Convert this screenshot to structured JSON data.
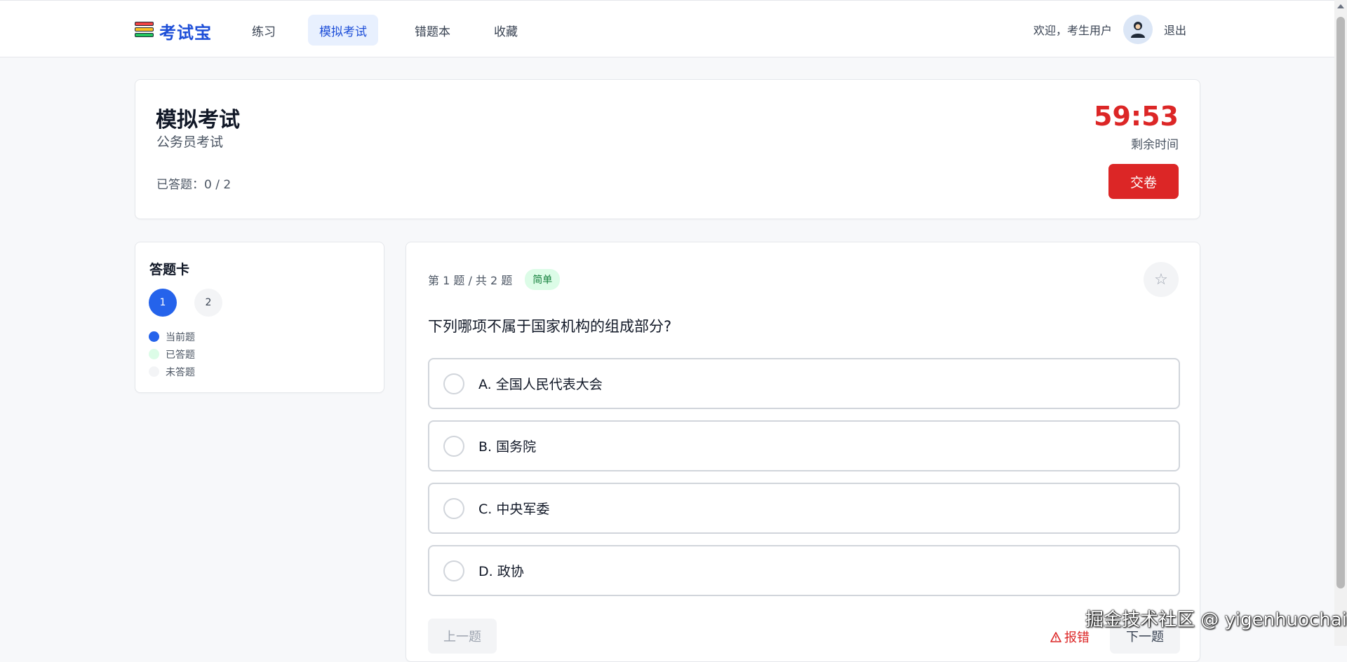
{
  "header": {
    "brand": "考试宝",
    "nav": [
      {
        "label": "练习",
        "active": false
      },
      {
        "label": "模拟考试",
        "active": true
      },
      {
        "label": "错题本",
        "active": false
      },
      {
        "label": "收藏",
        "active": false
      }
    ],
    "welcome": "欢迎，考生用户",
    "avatar_icon": "user-avatar-icon",
    "logout": "退出"
  },
  "exam": {
    "title": "模拟考试",
    "subtitle": "公务员考试",
    "progress": "已答题：0 / 2",
    "timer": "59:53",
    "timer_label": "剩余时间",
    "submit": "交卷"
  },
  "answer_sheet": {
    "title": "答题卡",
    "numbers": [
      {
        "n": "1",
        "state": "current"
      },
      {
        "n": "2",
        "state": "pending"
      }
    ],
    "legend": [
      {
        "label": "当前题",
        "color": "#2563eb"
      },
      {
        "label": "已答题",
        "color": "#dcfce7"
      },
      {
        "label": "未答题",
        "color": "#f3f4f6"
      }
    ]
  },
  "question": {
    "counter": "第 1 题 / 共 2 题",
    "difficulty": "简单",
    "favorite_icon": "star-icon",
    "favorite_glyph": "☆",
    "text": "下列哪项不属于国家机构的组成部分?",
    "options": [
      {
        "label": "A. 全国人民代表大会"
      },
      {
        "label": "B. 国务院"
      },
      {
        "label": "C. 中央军委"
      },
      {
        "label": "D. 政协"
      }
    ],
    "prev": "上一题",
    "report": "报错",
    "next": "下一题"
  },
  "watermark": "掘金技术社区 @ yigenhuochai",
  "colors": {
    "accent": "#2563eb",
    "brand": "#1d4ed8",
    "danger": "#dc2626",
    "success_bg": "#dcfce7"
  }
}
